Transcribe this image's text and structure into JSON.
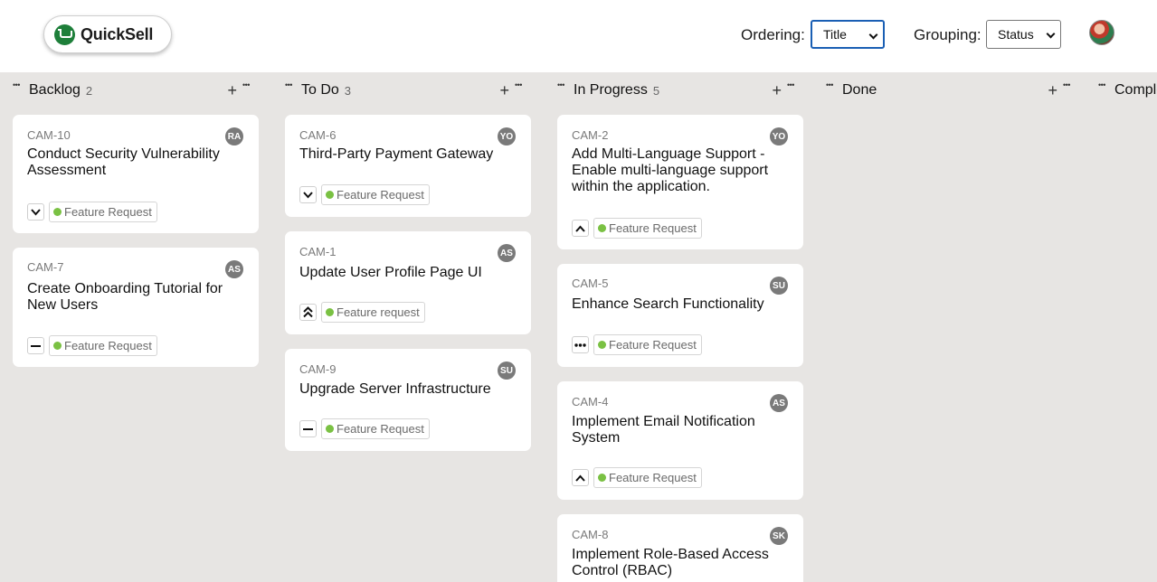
{
  "app": {
    "logo_text": "QuickSell"
  },
  "controls": {
    "ordering_label": "Ordering:",
    "ordering_value": "Title",
    "grouping_label": "Grouping:",
    "grouping_value": "Status"
  },
  "columns": [
    {
      "title": "Backlog",
      "count": "2"
    },
    {
      "title": "To Do",
      "count": "3"
    },
    {
      "title": "In Progress",
      "count": "5"
    },
    {
      "title": "Done",
      "count": ""
    },
    {
      "title": "Comple",
      "count": ""
    }
  ],
  "cards": {
    "backlog": [
      {
        "id": "CAM-10",
        "user": "RA",
        "title": "Conduct Security Vulnerability Assessment",
        "priority": "low",
        "tag": "Feature Request"
      },
      {
        "id": "CAM-7",
        "user": "AS",
        "title": "Create Onboarding Tutorial for New Users",
        "priority": "no-priority",
        "tag": "Feature Request"
      }
    ],
    "todo": [
      {
        "id": "CAM-6",
        "user": "YO",
        "title": "Third-Party Payment Gateway",
        "priority": "low",
        "tag": "Feature Request"
      },
      {
        "id": "CAM-1",
        "user": "AS",
        "title": "Update User Profile Page UI",
        "priority": "urgent",
        "tag": "Feature request"
      },
      {
        "id": "CAM-9",
        "user": "SU",
        "title": "Upgrade Server Infrastructure",
        "priority": "no-priority",
        "tag": "Feature Request"
      }
    ],
    "inprogress": [
      {
        "id": "CAM-2",
        "user": "YO",
        "title": "Add Multi-Language Support - Enable multi-language support within the application.",
        "priority": "high",
        "tag": "Feature Request"
      },
      {
        "id": "CAM-5",
        "user": "SU",
        "title": "Enhance Search Functionality",
        "priority": "medium",
        "tag": "Feature Request"
      },
      {
        "id": "CAM-4",
        "user": "AS",
        "title": "Implement Email Notification System",
        "priority": "high",
        "tag": "Feature Request"
      },
      {
        "id": "CAM-8",
        "user": "SK",
        "title": "Implement Role-Based Access Control (RBAC)",
        "priority": "",
        "tag": ""
      }
    ]
  },
  "colors": {
    "tag_dot": "#7ac143",
    "avatar": "#7a7a7a",
    "board_bg": "#e7e5e3"
  }
}
